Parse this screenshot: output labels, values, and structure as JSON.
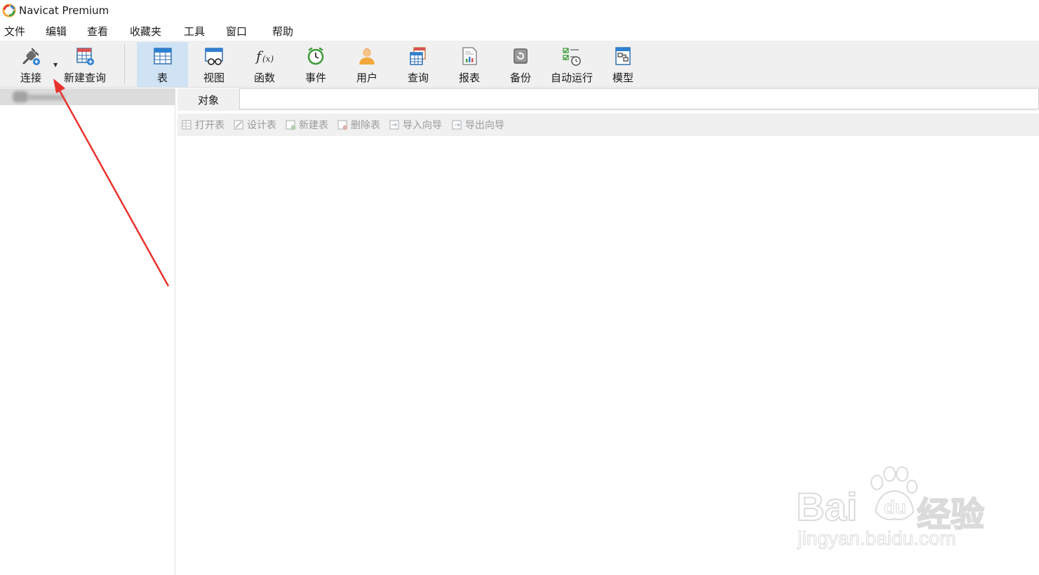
{
  "window": {
    "title": "Navicat Premium"
  },
  "menu": [
    "文件",
    "编辑",
    "查看",
    "收藏夹",
    "工具",
    "窗口",
    "帮助"
  ],
  "toolbar": {
    "connect": "连接",
    "new_query": "新建查询",
    "table": "表",
    "view": "视图",
    "function": "函数",
    "event": "事件",
    "user": "用户",
    "query": "查询",
    "report": "报表",
    "backup": "备份",
    "automation": "自动运行",
    "model": "模型"
  },
  "tabs": {
    "objects": "对象"
  },
  "object_toolbar": [
    "打开表",
    "设计表",
    "新建表",
    "删除表",
    "导入向导",
    "导出向导"
  ],
  "watermark": {
    "brand": "Bai",
    "brand_cn": "经验",
    "url": "jingyan.baidu.com"
  },
  "colors": {
    "active_tool": "#cfe3f5",
    "arrow": "#e8322e",
    "toolbar_bg": "#f0f0f0"
  }
}
